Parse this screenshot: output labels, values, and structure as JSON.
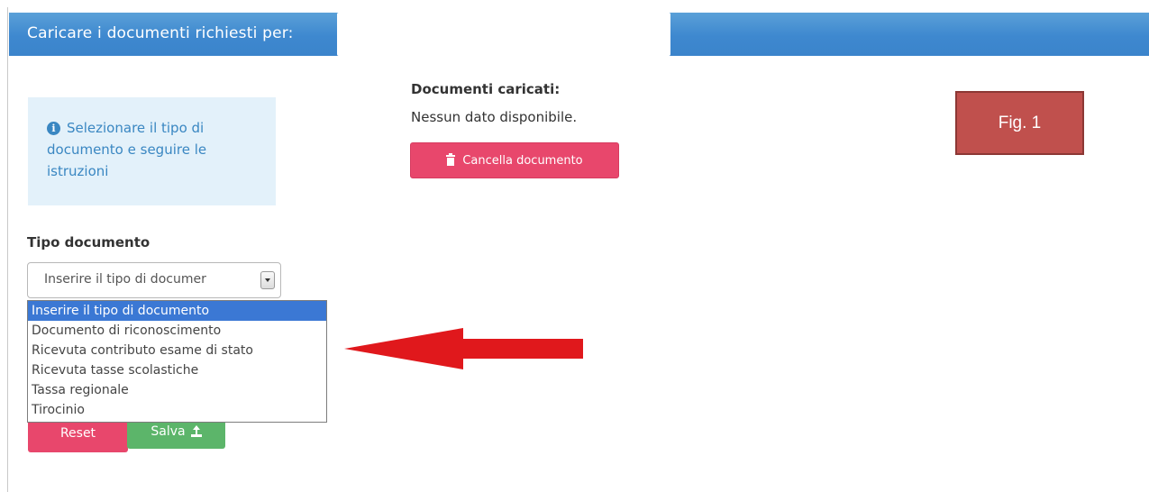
{
  "header": {
    "title": "Caricare i documenti richiesti per:",
    "field_value": ""
  },
  "info": {
    "icon": "info-icon",
    "text": "Selezionare il tipo di documento e seguire le istruzioni"
  },
  "uploaded": {
    "title": "Documenti caricati:",
    "empty_text": "Nessun dato disponibile.",
    "delete_button": {
      "icon": "trash-icon",
      "label": "Cancella documento",
      "color": "#e8476c"
    }
  },
  "figure_badge": {
    "label": "Fig. 1",
    "color": "#c0504d"
  },
  "form": {
    "tipo_label": "Tipo documento",
    "select_value": "Inserire il tipo di documer",
    "options": [
      "Inserire il tipo di documento",
      "Documento di riconoscimento",
      "Ricevuta contributo esame di stato",
      "Ricevuta tasse scolastiche",
      "Tassa regionale",
      "Tirocinio"
    ],
    "selected_index": 0,
    "reset_label": "Reset",
    "save_label": "Salva",
    "save_icon": "upload-icon"
  },
  "colors": {
    "header": "#3e88cf",
    "info_bg": "#e3f1fa",
    "save": "#5cb56a",
    "arrow": "#e0181c"
  }
}
